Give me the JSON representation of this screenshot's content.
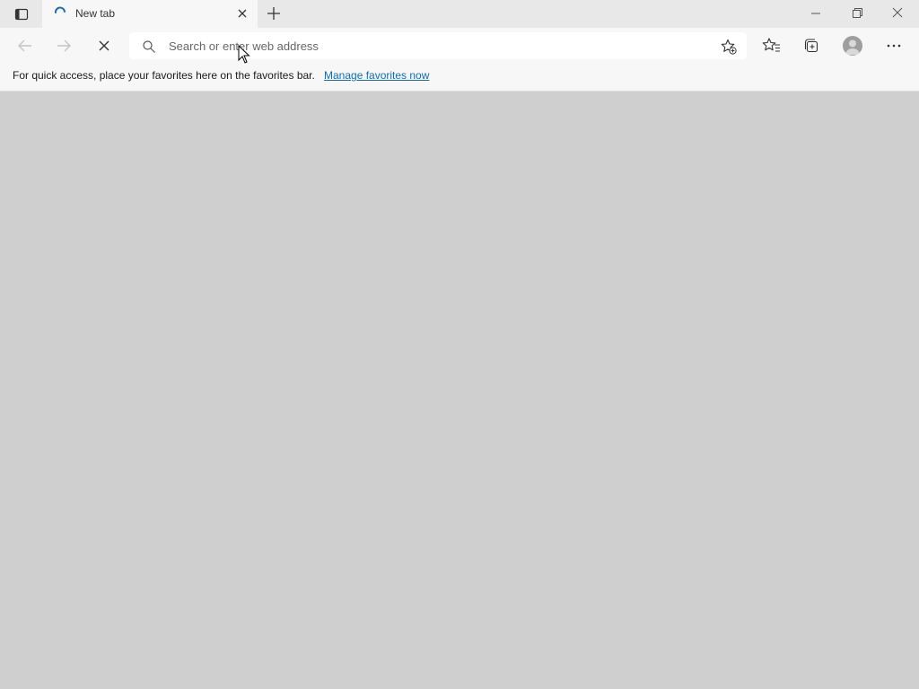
{
  "tab": {
    "title": "New tab"
  },
  "address_bar": {
    "placeholder": "Search or enter web address"
  },
  "favorites_bar": {
    "message": "For quick access, place your favorites here on the favorites bar.",
    "link_label": "Manage favorites now"
  },
  "icons": {
    "tab_actions": "tab-actions-icon",
    "loading": "loading-spinner-icon",
    "close_tab": "close-icon",
    "new_tab": "plus-icon",
    "minimize": "minimize-icon",
    "restore": "restore-icon",
    "close_window": "close-icon",
    "back": "arrow-left-icon",
    "forward": "arrow-right-icon",
    "stop": "stop-icon",
    "search": "search-icon",
    "add_favorite": "star-plus-icon",
    "favorites": "favorites-icon",
    "collections": "collections-icon",
    "profile": "profile-icon",
    "more": "more-icon"
  },
  "colors": {
    "link": "#0f6cbd",
    "content_background": "#cfcfcf",
    "spinner": "#1f6bb5"
  }
}
